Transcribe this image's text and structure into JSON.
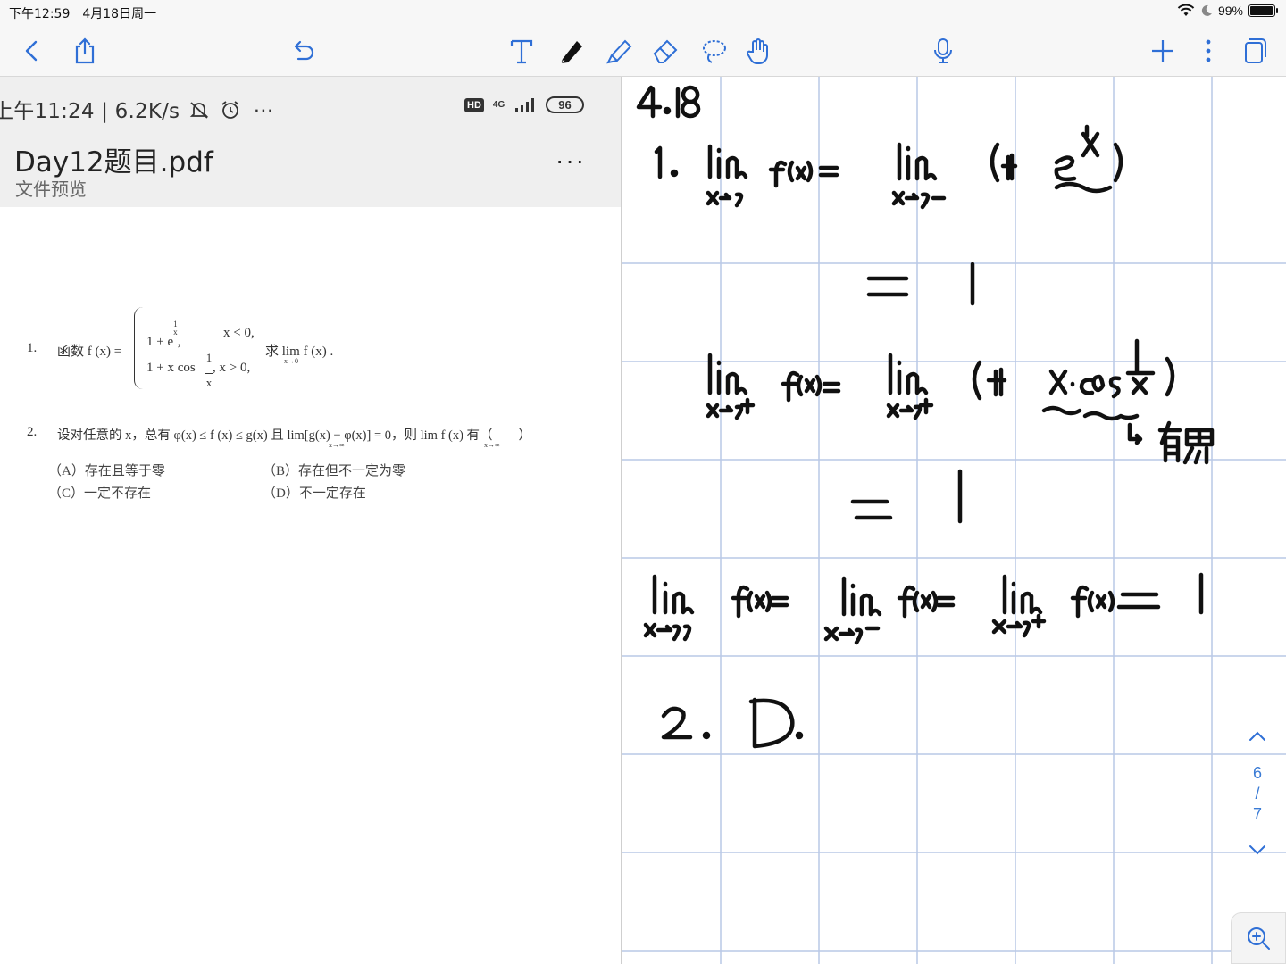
{
  "status_bar": {
    "time": "下午12:59",
    "date": "4月18日周一",
    "battery": "99%",
    "battery_level": 0.99
  },
  "toolbar": {
    "left": [
      "back-icon",
      "share-icon",
      "undo-icon"
    ],
    "center": [
      "text-icon",
      "pen-icon",
      "highlighter-icon",
      "eraser-icon",
      "lasso-icon",
      "hand-icon"
    ],
    "right": [
      "microphone-icon",
      "add-icon",
      "more-icon",
      "pages-icon"
    ],
    "accent": "#2f6fd6"
  },
  "phone": {
    "time": "上午11:24 | 6.2K/s",
    "hd": "HD",
    "network": "4G",
    "battery": "96"
  },
  "pdf": {
    "title": "Day12题目.pdf",
    "subtitle": "文件预览",
    "more": "···",
    "q1": {
      "num": "1.",
      "lead": "函数 f (x) =",
      "case1_expr": "1 + e",
      "case1_cond": "x < 0,",
      "case2_expr": "1 + x cos",
      "case2_cond": ", x > 0,",
      "ask": "求 lim f (x) .",
      "ask_sub": "x→0"
    },
    "q2": {
      "num": "2.",
      "text": "设对任意的 x，总有 φ(x) ≤ f (x) ≤ g(x) 且 lim[g(x) − φ(x)] = 0，则 lim f (x) 有（　　）",
      "sub1": "x→∞",
      "sub2": "x→∞",
      "options": [
        "（A）存在且等于零",
        "（B）存在但不一定为零",
        "（C）一定不存在",
        "（D）不一定存在"
      ]
    }
  },
  "notebook": {
    "date": "4.18",
    "ink_color": "#111111",
    "grid_color": "#b9c9e6",
    "answers": {
      "q1_line1": "1. lim f(x) = lim (1+e^(1/x))",
      "q1_line2": "= 1",
      "q1_line3": "lim f(x) = lim (1+ x·cos 1/x)",
      "q1_note": "有界",
      "q1_line4": "= 1",
      "q1_line5": "lim f(x) = lim f(x) = lim f(x) = 1",
      "q2": "2. D."
    }
  },
  "page_nav": {
    "current": "6",
    "sep": "/",
    "total": "7"
  }
}
